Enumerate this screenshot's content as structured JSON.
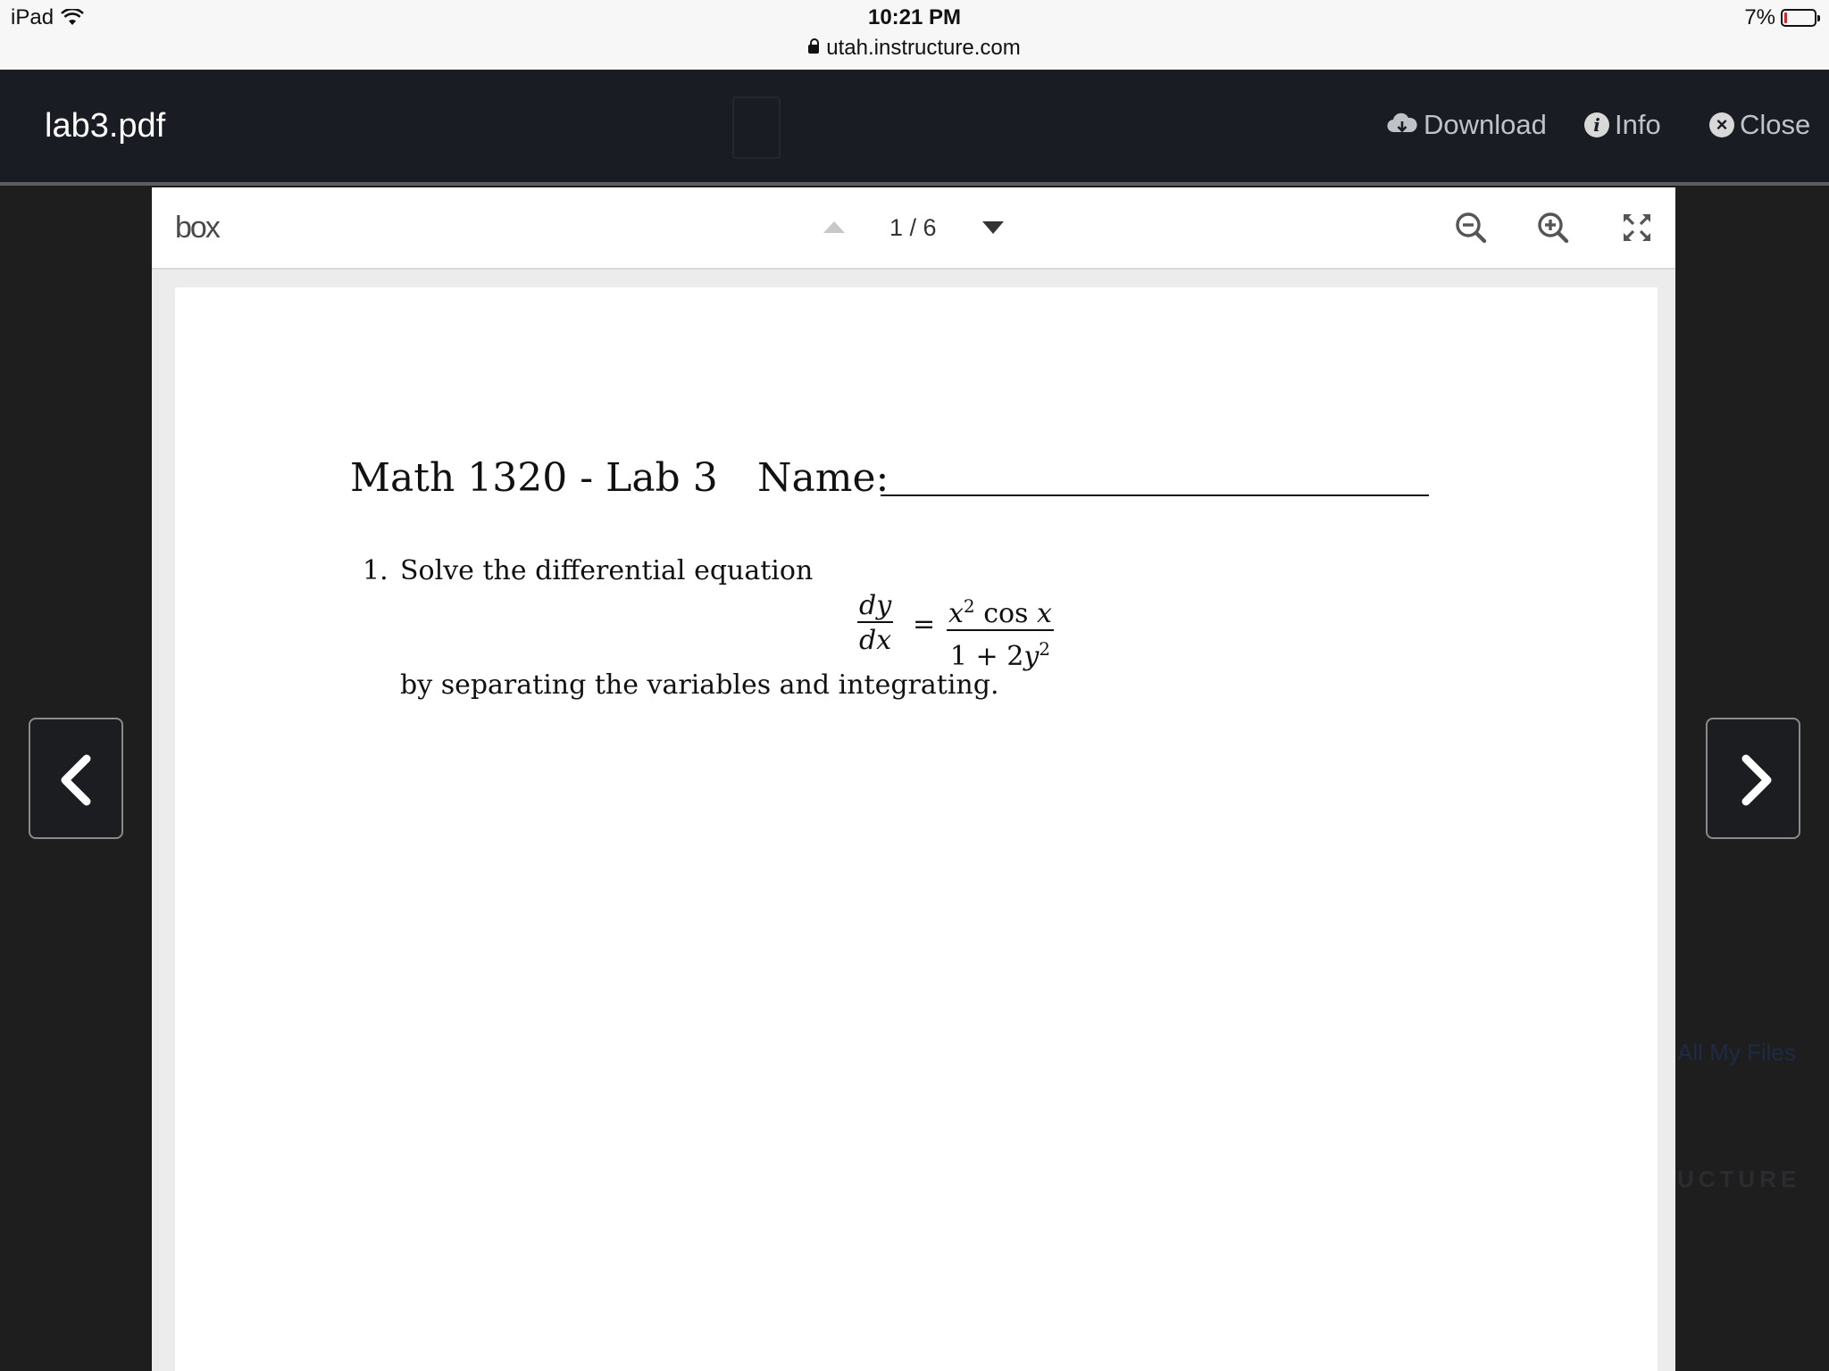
{
  "status_bar": {
    "device": "iPad",
    "time": "10:21 PM",
    "url": "utah.instructure.com",
    "battery": "7%",
    "battery_level": 0.07
  },
  "header": {
    "file_title": "lab3.pdf",
    "buttons": {
      "download": "Download",
      "info": "Info",
      "close": "Close"
    }
  },
  "viewer": {
    "logo": "box",
    "page_indicator": "1 / 6"
  },
  "document": {
    "title": "Math 1320 - Lab 3",
    "name_label": "Name:",
    "question_number": "1.",
    "question_intro": "Solve the differential equation",
    "question_outro": "by separating the variables and integrating."
  },
  "background": {
    "all_my_files": "All My Files",
    "brand_fragment": "UCTURE"
  }
}
